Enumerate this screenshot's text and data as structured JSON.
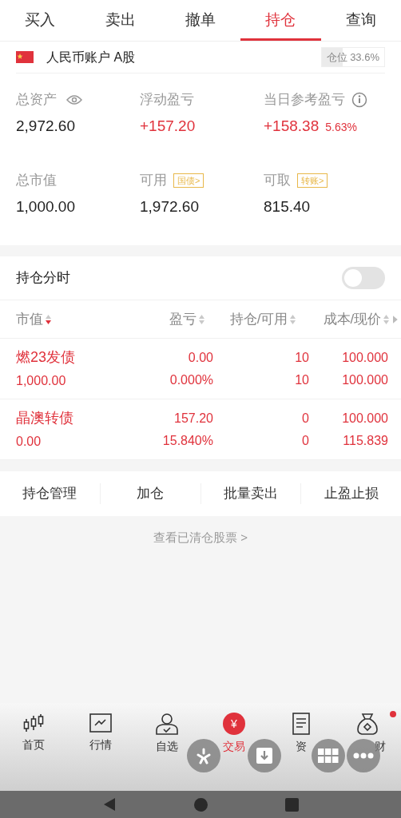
{
  "tabs": [
    {
      "label": "买入",
      "selected": false
    },
    {
      "label": "卖出",
      "selected": false
    },
    {
      "label": "撤单",
      "selected": false
    },
    {
      "label": "持仓",
      "selected": true
    },
    {
      "label": "查询",
      "selected": false
    }
  ],
  "account": {
    "name": "人民币账户 A股",
    "position": "仓位 33.6%",
    "level": 0.336
  },
  "stats": [
    {
      "label": "总资产",
      "value": "2,972.60",
      "red": false
    },
    {
      "label": "浮动盈亏",
      "value": "+157.20",
      "red": true
    },
    {
      "label": "当日参考盈亏",
      "value": "+158.38",
      "extra": "5.63%",
      "red": true
    },
    {
      "label": "总市值",
      "value": "1,000.00",
      "red": false
    },
    {
      "label": "可用",
      "tag": "国债>",
      "value": "1,972.60",
      "red": false
    },
    {
      "label": "可取",
      "tag": "转账>",
      "value": "815.40",
      "red": false
    }
  ],
  "intraday": {
    "label": "持仓分时",
    "on": false
  },
  "columns": [
    {
      "label": "市值",
      "sorted": true
    },
    {
      "label": "盈亏",
      "sorted": false
    },
    {
      "label": "持仓/可用",
      "sorted": false
    },
    {
      "label": "成本/现价",
      "sorted": false
    }
  ],
  "rows": [
    {
      "name": "燃23发债",
      "value": "1,000.00",
      "pl": "0.00",
      "pl_pct": "0.000%",
      "hold": "10",
      "avail": "10",
      "cost": "100.000",
      "price": "100.000"
    },
    {
      "name": "晶澳转债",
      "value": "0.00",
      "pl": "157.20",
      "pl_pct": "15.840%",
      "hold": "0",
      "avail": "0",
      "cost": "100.000",
      "price": "115.839"
    }
  ],
  "actions": [
    "持仓管理",
    "加仓",
    "批量卖出",
    "止盈止损"
  ],
  "cleared_link": "查看已清仓股票 >",
  "nav": [
    {
      "label": "首页",
      "selected": false,
      "dot": false
    },
    {
      "label": "行情",
      "selected": false,
      "dot": false
    },
    {
      "label": "自选",
      "selected": false,
      "dot": false
    },
    {
      "label": "交易",
      "badge": "¥",
      "selected": true,
      "dot": false
    },
    {
      "label": "资",
      "selected": false,
      "dot": false
    },
    {
      "label": "财",
      "selected": false,
      "dot": true
    }
  ],
  "floating": [
    {
      "kind": "star"
    },
    {
      "kind": "download"
    },
    {
      "kind": "grid"
    },
    {
      "kind": "more"
    }
  ]
}
